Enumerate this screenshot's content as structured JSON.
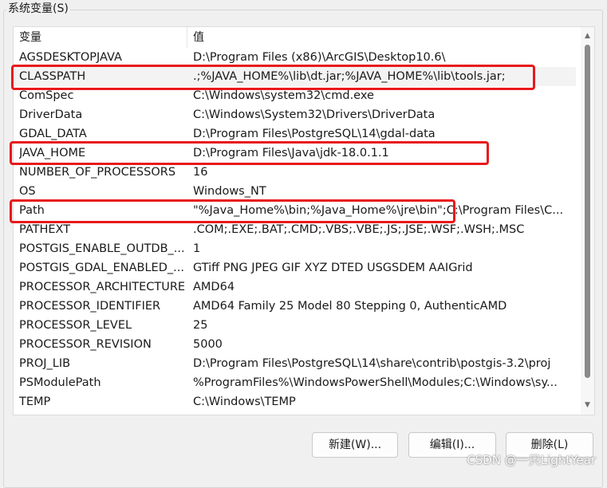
{
  "group": {
    "title": "系统变量(S)"
  },
  "table": {
    "columns": {
      "name": "变量",
      "value": "值"
    },
    "rows": [
      {
        "name": "AGSDESKTOPJAVA",
        "value": "D:\\Program Files (x86)\\ArcGIS\\Desktop10.6\\"
      },
      {
        "name": "CLASSPATH",
        "value": ".;%JAVA_HOME%\\lib\\dt.jar;%JAVA_HOME%\\lib\\tools.jar;"
      },
      {
        "name": "ComSpec",
        "value": "C:\\Windows\\system32\\cmd.exe"
      },
      {
        "name": "DriverData",
        "value": "C:\\Windows\\System32\\Drivers\\DriverData"
      },
      {
        "name": "GDAL_DATA",
        "value": "D:\\Program Files\\PostgreSQL\\14\\gdal-data"
      },
      {
        "name": "JAVA_HOME",
        "value": "D:\\Program Files\\Java\\jdk-18.0.1.1"
      },
      {
        "name": "NUMBER_OF_PROCESSORS",
        "value": "16"
      },
      {
        "name": "OS",
        "value": "Windows_NT"
      },
      {
        "name": "Path",
        "value": "\"%Java_Home%\\bin;%Java_Home%\\jre\\bin\";C:\\Program Files\\C..."
      },
      {
        "name": "PATHEXT",
        "value": ".COM;.EXE;.BAT;.CMD;.VBS;.VBE;.JS;.JSE;.WSF;.WSH;.MSC"
      },
      {
        "name": "POSTGIS_ENABLE_OUTDB_...",
        "value": "1"
      },
      {
        "name": "POSTGIS_GDAL_ENABLED_...",
        "value": "GTiff PNG JPEG GIF XYZ DTED USGSDEM AAIGrid"
      },
      {
        "name": "PROCESSOR_ARCHITECTURE",
        "value": "AMD64"
      },
      {
        "name": "PROCESSOR_IDENTIFIER",
        "value": "AMD64 Family 25 Model 80 Stepping 0, AuthenticAMD"
      },
      {
        "name": "PROCESSOR_LEVEL",
        "value": "25"
      },
      {
        "name": "PROCESSOR_REVISION",
        "value": "5000"
      },
      {
        "name": "PROJ_LIB",
        "value": "D:\\Program Files\\PostgreSQL\\14\\share\\contrib\\postgis-3.2\\proj"
      },
      {
        "name": "PSModulePath",
        "value": "%ProgramFiles%\\WindowsPowerShell\\Modules;C:\\Windows\\sy..."
      },
      {
        "name": "TEMP",
        "value": "C:\\Windows\\TEMP"
      }
    ]
  },
  "buttons": {
    "new": "新建(W)...",
    "edit": "编辑(I)...",
    "delete": "删除(L)"
  },
  "watermark": "CSDN @一只LightYear",
  "colors": {
    "highlight": "#e8191c",
    "window_bg": "#f0f0f0"
  }
}
